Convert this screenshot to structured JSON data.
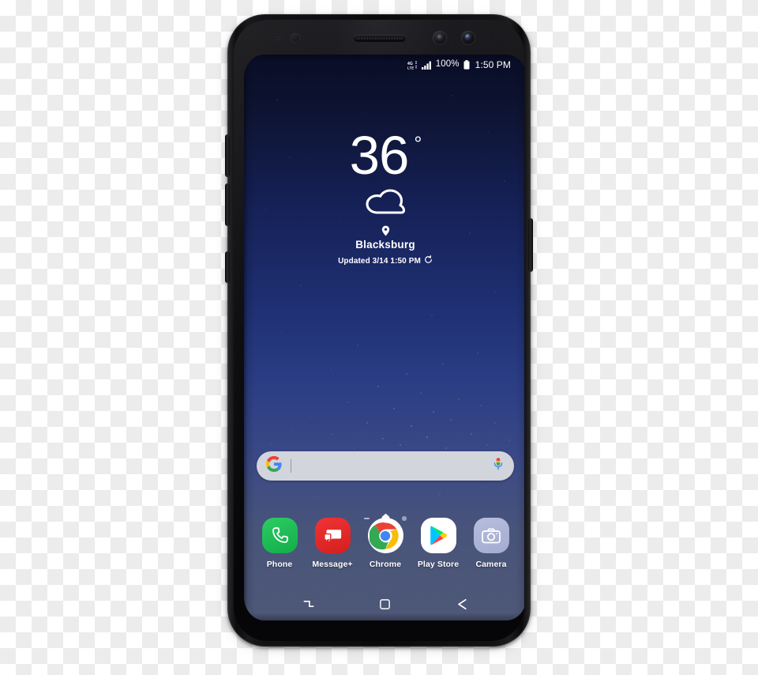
{
  "device": {
    "name": "samsung-galaxy-s8",
    "hardware": {
      "speaker": "earpiece-speaker",
      "iris_scanner": "iris-scanner",
      "front_camera": "front-camera",
      "proximity_sensor": "proximity-sensor",
      "volume_up": "volume-up-button",
      "volume_down": "volume-down-button",
      "bixby": "bixby-button",
      "power": "power-button"
    }
  },
  "status_bar": {
    "network_type": "4G LTE",
    "network_icon": "lte-signal-icon",
    "signal_icon": "signal-bars-icon",
    "battery_percent": "100%",
    "battery_icon": "battery-full-icon",
    "time": "1:50 PM"
  },
  "weather_widget": {
    "temperature": "36",
    "degree_symbol": "°",
    "condition_icon": "cloud-icon",
    "location_icon": "location-pin-icon",
    "city": "Blacksburg",
    "updated_text": "Updated 3/14 1:50 PM",
    "refresh_icon": "refresh-icon"
  },
  "search_bar": {
    "logo_icon": "google-g-icon",
    "value": "",
    "placeholder": "",
    "mic_icon": "microphone-icon"
  },
  "page_indicators": {
    "items": [
      {
        "type": "dash",
        "icon": "page-dash-icon",
        "active": false
      },
      {
        "type": "home",
        "icon": "home-page-icon",
        "active": true
      },
      {
        "type": "dot",
        "icon": "page-dot-icon",
        "active": false
      }
    ]
  },
  "dock": {
    "apps": [
      {
        "label": "Phone",
        "icon": "phone-icon",
        "color": "#1dbb55"
      },
      {
        "label": "Message+",
        "icon": "message-icon",
        "color": "#e32b2b"
      },
      {
        "label": "Chrome",
        "icon": "chrome-icon",
        "color": "#ffffff"
      },
      {
        "label": "Play Store",
        "icon": "play-store-icon",
        "color": "#ffffff"
      },
      {
        "label": "Camera",
        "icon": "camera-icon",
        "color": "#aeb5d6"
      }
    ]
  },
  "nav_bar": {
    "recents_icon": "recents-icon",
    "home_icon": "home-icon",
    "back_icon": "back-icon"
  },
  "theme": {
    "wallpaper_top": "#090d26",
    "wallpaper_mid": "#1e2f72",
    "wallpaper_bottom": "#4e5878",
    "search_bg": "#d3d5dd",
    "text_primary": "#ffffff"
  }
}
